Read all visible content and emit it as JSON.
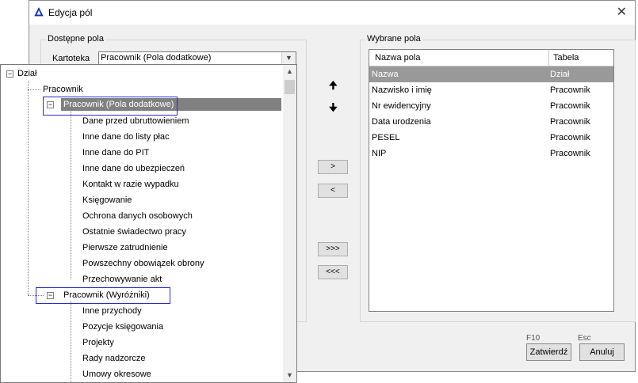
{
  "window": {
    "title": "Edycja pól",
    "close_glyph": "✕"
  },
  "available": {
    "group_label": "Dostępne pola",
    "kartoteka_label": "Kartoteka",
    "kartoteka_value": "Pracownik (Pola dodatkowe)"
  },
  "selected": {
    "group_label": "Wybrane pola",
    "columns": [
      "Nazwa pola",
      "Tabela"
    ],
    "rows": [
      {
        "name": "Nazwa",
        "table": "Dział",
        "selected": true
      },
      {
        "name": "Nazwisko i imię",
        "table": "Pracownik"
      },
      {
        "name": "Nr ewidencyjny",
        "table": "Pracownik"
      },
      {
        "name": "Data urodzenia",
        "table": "Pracownik"
      },
      {
        "name": "PESEL",
        "table": "Pracownik"
      },
      {
        "name": "NIP",
        "table": "Pracownik"
      }
    ]
  },
  "move_buttons": {
    "add": ">",
    "remove": "<",
    "add_all": ">>>",
    "remove_all": "<<<"
  },
  "order_arrows": {
    "up": "🠉",
    "down": "🠋"
  },
  "footer": {
    "ok_hint": "F10",
    "ok_label": "Zatwierdź",
    "cancel_hint": "Esc",
    "cancel_label": "Anuluj"
  },
  "tree": {
    "nodes": [
      {
        "label": "Dział"
      },
      {
        "label": "Pracownik"
      },
      {
        "label": "Pracownik (Pola dodatkowe)"
      },
      {
        "label": "Dane przed ubruttowieniem"
      },
      {
        "label": "Inne dane do listy płac"
      },
      {
        "label": "Inne dane do PIT"
      },
      {
        "label": "Inne dane do ubezpieczeń"
      },
      {
        "label": "Kontakt w razie wypadku"
      },
      {
        "label": "Księgowanie"
      },
      {
        "label": "Ochrona danych osobowych"
      },
      {
        "label": "Ostatnie świadectwo pracy"
      },
      {
        "label": "Pierwsze zatrudnienie"
      },
      {
        "label": "Powszechny obowiązek obrony"
      },
      {
        "label": "Przechowywanie akt"
      },
      {
        "label": "Pracownik (Wyróżniki)"
      },
      {
        "label": "Inne przychody"
      },
      {
        "label": "Pozycje księgowania"
      },
      {
        "label": "Projekty"
      },
      {
        "label": "Rady nadzorcze"
      },
      {
        "label": "Umowy okresowe"
      }
    ]
  },
  "colors": {
    "selection": "#808080",
    "highlight_border": "#2a2ad0",
    "title_icon": "#1a3fd1"
  }
}
